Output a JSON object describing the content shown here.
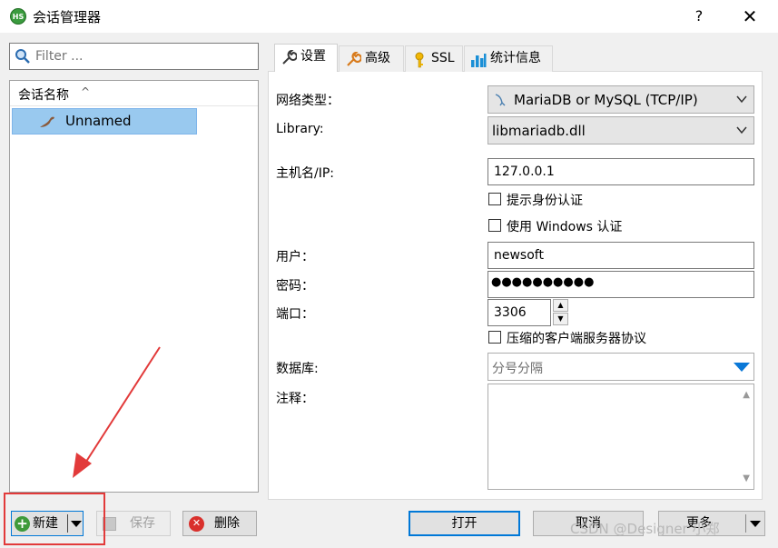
{
  "window": {
    "title": "会话管理器",
    "help_glyph": "?",
    "close_glyph": "✕",
    "app_icon_text": "HS"
  },
  "filter": {
    "placeholder": "Filter ..."
  },
  "tree": {
    "column_header": "会话名称",
    "sort_glyph": "^",
    "items": [
      {
        "label": "Unnamed",
        "selected": true
      }
    ]
  },
  "tabs": [
    {
      "label": "设置",
      "icon": "wrench-icon",
      "active": true
    },
    {
      "label": "高级",
      "icon": "wrench-orange-icon",
      "active": false
    },
    {
      "label": "SSL",
      "icon": "key-icon",
      "active": false
    },
    {
      "label": "统计信息",
      "icon": "bar-chart-icon",
      "active": false
    }
  ],
  "settings": {
    "network_type_label": "网络类型：",
    "network_type_value": "MariaDB or MySQL (TCP/IP)",
    "library_label": "Library:",
    "library_value": "libmariadb.dll",
    "host_label": "主机名/IP:",
    "host_value": "127.0.0.1",
    "prompt_auth_label": "提示身份认证",
    "windows_auth_label": "使用 Windows 认证",
    "user_label": "用户：",
    "user_value": "newsoft",
    "password_label": "密码：",
    "password_value": "●●●●●●●●●●",
    "port_label": "端口：",
    "port_value": "3306",
    "compress_label": "压缩的客户端服务器协议",
    "database_label": "数据库:",
    "database_placeholder": "分号分隔",
    "comment_label": "注释："
  },
  "buttons": {
    "new": "新建",
    "save": "保存",
    "delete": "删除",
    "open": "打开",
    "cancel": "取消",
    "more": "更多"
  },
  "watermark": "CSDN @Designer 小郑",
  "colors": {
    "accent": "#0078d7",
    "selection": "#99c9ef",
    "highlight": "#e23a3a"
  }
}
